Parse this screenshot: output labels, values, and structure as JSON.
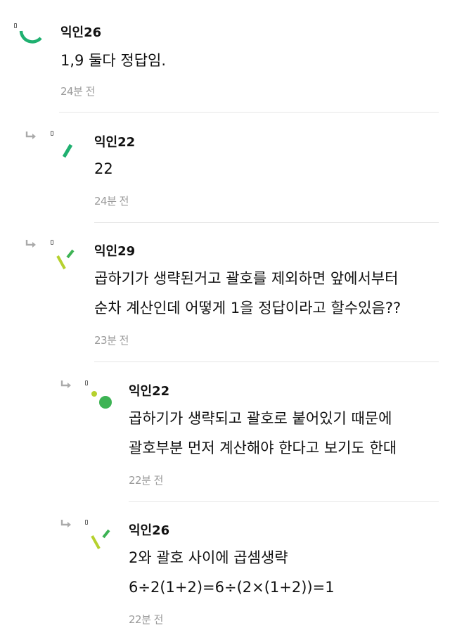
{
  "comments": [
    {
      "author": "익인26",
      "lines": [
        "1,9 둘다 정답임."
      ],
      "time": "24분 전",
      "avatar_color": "#1fb070"
    },
    {
      "author": "익인22",
      "lines": [
        "22"
      ],
      "time": "24분 전",
      "avatar_color": "#1fb070"
    },
    {
      "author": "익인29",
      "lines": [
        "곱하기가 생략된거고 괄호를 제외하면 앞에서부터",
        "순차 계산인데 어떻게 1을 정답이라고 할수있음??"
      ],
      "time": "23분 전",
      "avatar_color": "#b6d12e"
    },
    {
      "author": "익인22",
      "lines": [
        "곱하기가 생략되고 괄호로 붙어있기 때문에",
        "괄호부분 먼저 계산해야 한다고 보기도 한대"
      ],
      "time": "22분 전",
      "avatar_color": "#3db354"
    },
    {
      "author": "익인26",
      "lines": [
        "2와 괄호 사이에 곱셈생략",
        "6÷2(1+2)=6÷(2×(1+2))=1"
      ],
      "time": "22분 전",
      "avatar_color": "#b6d12e"
    }
  ],
  "icons": {
    "reply": "reply-arrow-icon",
    "marker": "small-marker-icon"
  }
}
